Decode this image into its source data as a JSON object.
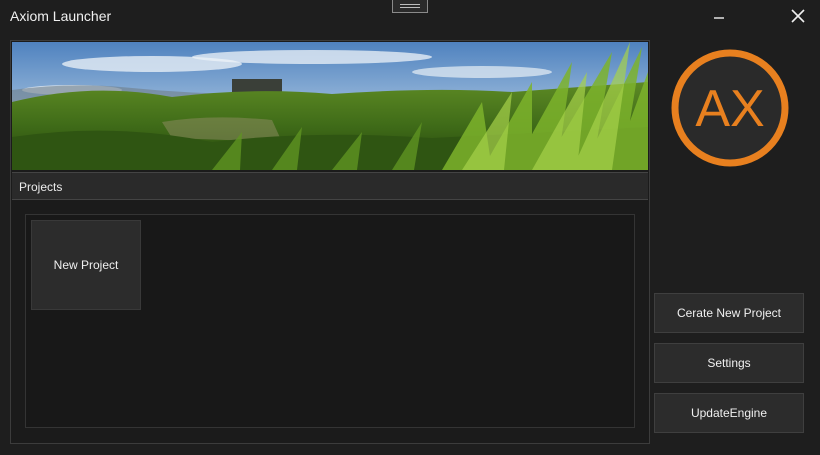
{
  "window": {
    "title": "Axiom Launcher"
  },
  "icons": {
    "grip": "drag-handle-icon",
    "minimize": "minimize-icon",
    "close": "close-icon"
  },
  "projects_panel": {
    "header": "Projects",
    "items": [
      {
        "label": "New Project"
      }
    ]
  },
  "logo": {
    "text": "AX",
    "ring_color": "#e8801f",
    "fill_color": "#2a2a2a"
  },
  "sidebar": {
    "buttons": [
      {
        "label": "Cerate New Project"
      },
      {
        "label": "Settings"
      },
      {
        "label": "UpdateEngine"
      }
    ]
  },
  "colors": {
    "background": "#1e1e1e",
    "accent": "#e8801f"
  }
}
